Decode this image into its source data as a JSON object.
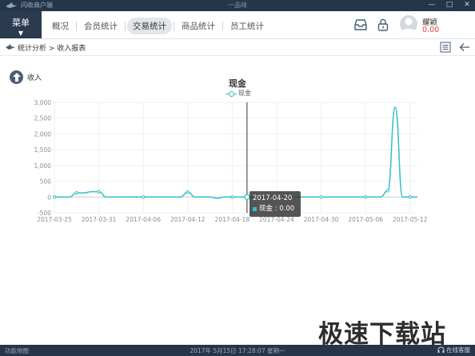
{
  "window": {
    "app_title": "闪收商户端",
    "center_title": "一品味",
    "controls": [
      "—",
      "□",
      "✕"
    ]
  },
  "menu": {
    "label": "菜单",
    "caret": "▼"
  },
  "nav": {
    "tabs": [
      {
        "label": "概况",
        "active": false
      },
      {
        "label": "会员统计",
        "active": false
      },
      {
        "label": "交易统计",
        "active": true
      },
      {
        "label": "商品统计",
        "active": false
      },
      {
        "label": "员工统计",
        "active": false
      }
    ]
  },
  "user": {
    "name": "耀颖",
    "balance": "0.00"
  },
  "breadcrumb": {
    "text": "统计分析 > 收入报表"
  },
  "income_button": {
    "label": "收入"
  },
  "chart_data": {
    "type": "line",
    "title": "现金",
    "legend": [
      "现金"
    ],
    "legend_position": "top-center",
    "grid": true,
    "xlabel": "",
    "ylabel": "",
    "ylim": [
      -500,
      3000
    ],
    "yticks": [
      "3,000",
      "2,500",
      "2,000",
      "1,500",
      "1,000",
      "500",
      "0",
      "-500"
    ],
    "xticks": [
      "2017-03-25",
      "2017-03-31",
      "2017-04-06",
      "2017-04-12",
      "2017-04-18",
      "2017-04-24",
      "2017-04-30",
      "2017-05-06",
      "2017-05-12"
    ],
    "series": [
      {
        "name": "现金",
        "color": "#31c0c7",
        "x": [
          "2017-03-25",
          "2017-03-26",
          "2017-03-27",
          "2017-03-28",
          "2017-03-29",
          "2017-03-30",
          "2017-03-31",
          "2017-04-01",
          "2017-04-02",
          "2017-04-03",
          "2017-04-04",
          "2017-04-05",
          "2017-04-06",
          "2017-04-07",
          "2017-04-08",
          "2017-04-09",
          "2017-04-10",
          "2017-04-11",
          "2017-04-12",
          "2017-04-13",
          "2017-04-14",
          "2017-04-15",
          "2017-04-16",
          "2017-04-17",
          "2017-04-18",
          "2017-04-19",
          "2017-04-20",
          "2017-04-21",
          "2017-04-22",
          "2017-04-23",
          "2017-04-24",
          "2017-04-25",
          "2017-04-26",
          "2017-04-27",
          "2017-04-28",
          "2017-04-29",
          "2017-04-30",
          "2017-05-01",
          "2017-05-02",
          "2017-05-03",
          "2017-05-04",
          "2017-05-05",
          "2017-05-06",
          "2017-05-07",
          "2017-05-08",
          "2017-05-09",
          "2017-05-10",
          "2017-05-11",
          "2017-05-12",
          "2017-05-13"
        ],
        "values": [
          0,
          0,
          0,
          130,
          130,
          170,
          170,
          0,
          0,
          0,
          0,
          0,
          0,
          0,
          0,
          0,
          0,
          0,
          160,
          0,
          0,
          0,
          -40,
          0,
          0,
          0,
          0,
          0,
          0,
          0,
          0,
          0,
          0,
          0,
          0,
          0,
          0,
          0,
          0,
          0,
          0,
          0,
          0,
          0,
          0,
          200,
          2850,
          0,
          0,
          0
        ]
      }
    ],
    "highlight_x": "2017-04-20",
    "tooltip": {
      "date": "2017-04-20",
      "label": "现金 : 0.00"
    }
  },
  "watermark": "极速下载站",
  "status": {
    "left": "功能地图",
    "center": "2017年 5月15日 17:28:07 星期一",
    "right": "在线客服"
  }
}
